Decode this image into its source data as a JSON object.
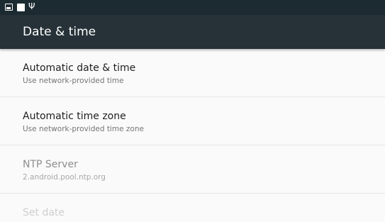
{
  "status_bar": {
    "icons": [
      "image-notification-icon",
      "square-notification-icon",
      "usb-icon"
    ],
    "usb_glyph": "Ψ"
  },
  "app_bar": {
    "title": "Date & time",
    "background": "#263238"
  },
  "preferences": [
    {
      "title": "Automatic date & time",
      "summary": "Use network-provided time",
      "enabled": true
    },
    {
      "title": "Automatic time zone",
      "summary": "Use network-provided time zone",
      "enabled": true
    },
    {
      "title": "NTP Server",
      "summary": "2.android.pool.ntp.org",
      "enabled": false
    },
    {
      "title": "Set date",
      "summary": "",
      "enabled": false
    }
  ]
}
